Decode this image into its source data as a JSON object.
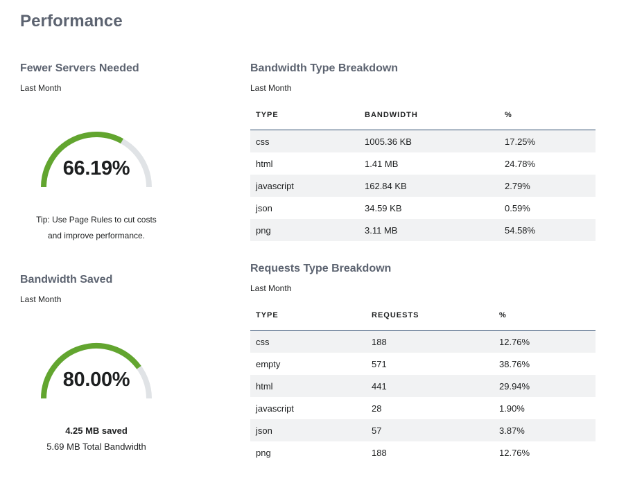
{
  "page": {
    "title": "Performance"
  },
  "servers": {
    "title": "Fewer Servers Needed",
    "subtitle": "Last Month",
    "gauge_value_text": "66.19%",
    "gauge_fraction": 0.6619,
    "tip_line1": "Tip: Use Page Rules to cut costs",
    "tip_line2": "and improve performance."
  },
  "bandwidth_saved": {
    "title": "Bandwidth Saved",
    "subtitle": "Last Month",
    "gauge_value_text": "80.00%",
    "gauge_fraction": 0.8,
    "saved_text": "4.25 MB saved",
    "total_text": "5.69 MB Total Bandwidth"
  },
  "bandwidth_breakdown": {
    "title": "Bandwidth Type Breakdown",
    "subtitle": "Last Month",
    "headers": [
      "TYPE",
      "BANDWIDTH",
      "%"
    ],
    "rows": [
      [
        "css",
        "1005.36 KB",
        "17.25%"
      ],
      [
        "html",
        "1.41 MB",
        "24.78%"
      ],
      [
        "javascript",
        "162.84 KB",
        "2.79%"
      ],
      [
        "json",
        "34.59 KB",
        "0.59%"
      ],
      [
        "png",
        "3.11 MB",
        "54.58%"
      ]
    ]
  },
  "requests_breakdown": {
    "title": "Requests Type Breakdown",
    "subtitle": "Last Month",
    "headers": [
      "TYPE",
      "REQUESTS",
      "%"
    ],
    "rows": [
      [
        "css",
        "188",
        "12.76%"
      ],
      [
        "empty",
        "571",
        "38.76%"
      ],
      [
        "html",
        "441",
        "29.94%"
      ],
      [
        "javascript",
        "28",
        "1.90%"
      ],
      [
        "json",
        "57",
        "3.87%"
      ],
      [
        "png",
        "188",
        "12.76%"
      ]
    ]
  },
  "colors": {
    "gauge_fill": "#62a52f",
    "gauge_track": "#e0e3e6",
    "heading": "#5c6370",
    "stripe": "#f1f2f3",
    "header_rule": "#2c4a6e"
  }
}
